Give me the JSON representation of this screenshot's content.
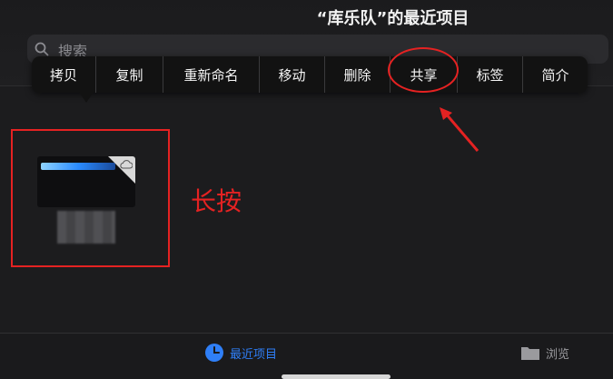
{
  "header": {
    "title": "“库乐队”的最近项目"
  },
  "search": {
    "placeholder": "搜索"
  },
  "context_menu": {
    "items": [
      {
        "label": "拷贝"
      },
      {
        "label": "复制"
      },
      {
        "label": "重新命名"
      },
      {
        "label": "移动"
      },
      {
        "label": "删除"
      },
      {
        "label": "共享"
      },
      {
        "label": "标签"
      },
      {
        "label": "简介"
      }
    ]
  },
  "annotations": {
    "long_press_label": "长按",
    "color": "#e52222"
  },
  "tab_bar": {
    "recents": {
      "label": "最近项目",
      "icon": "clock-icon",
      "color": "#2f7ff7"
    },
    "browse": {
      "label": "浏览",
      "icon": "folder-icon"
    }
  }
}
